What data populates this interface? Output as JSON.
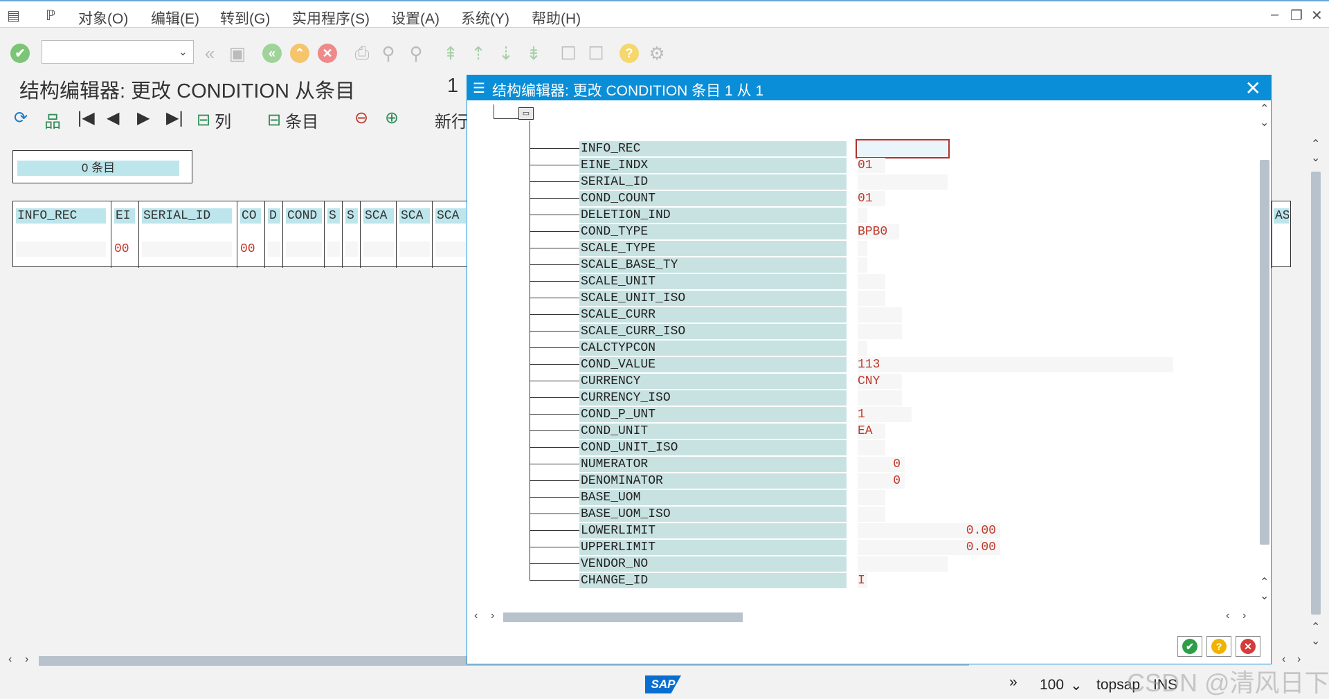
{
  "menu": {
    "items": [
      "对象(O)",
      "编辑(E)",
      "转到(G)",
      "实用程序(S)",
      "设置(A)",
      "系统(Y)",
      "帮助(H)"
    ]
  },
  "window_controls": {
    "minimize": "–",
    "restore": "❐",
    "close": "✕"
  },
  "toolbar": {
    "command_field_value": "",
    "icons": [
      "check-icon",
      "back-icon",
      "save-icon",
      "green-back-icon",
      "up-icon",
      "cancel-icon",
      "print-icon",
      "find-icon",
      "find-next-icon",
      "first-page-icon",
      "prev-page-icon",
      "next-page-icon",
      "last-page-icon",
      "create-session-icon",
      "shortcut-icon",
      "help-icon",
      "settings-icon"
    ]
  },
  "page": {
    "title": "结构编辑器: 更改 CONDITION 从条目",
    "title_num": "1"
  },
  "app_toolbar": {
    "col_label": "列",
    "entry_label": "条目",
    "new_row_label": "新行"
  },
  "count_box": {
    "label": "0 条目"
  },
  "grid": {
    "columns": [
      {
        "header": "INFO_REC",
        "value": ""
      },
      {
        "header": "EI",
        "value": "00"
      },
      {
        "header": "SERIAL_ID",
        "value": ""
      },
      {
        "header": "CO",
        "value": "00"
      },
      {
        "header": "D",
        "value": ""
      },
      {
        "header": "COND",
        "value": ""
      },
      {
        "header": "S",
        "value": ""
      },
      {
        "header": "S",
        "value": ""
      },
      {
        "header": "SCA",
        "value": ""
      },
      {
        "header": "SCA",
        "value": ""
      },
      {
        "header": "SCA",
        "value": ""
      }
    ],
    "right_header": "AS"
  },
  "dialog": {
    "title": "结构编辑器: 更改 CONDITION 条目 1 从 1",
    "fields": [
      {
        "name": "INFO_REC",
        "value": ""
      },
      {
        "name": "EINE_INDX",
        "value": "01"
      },
      {
        "name": "SERIAL_ID",
        "value": ""
      },
      {
        "name": "COND_COUNT",
        "value": "01"
      },
      {
        "name": "DELETION_IND",
        "value": ""
      },
      {
        "name": "COND_TYPE",
        "value": "BPB0"
      },
      {
        "name": "SCALE_TYPE",
        "value": ""
      },
      {
        "name": "SCALE_BASE_TY",
        "value": ""
      },
      {
        "name": "SCALE_UNIT",
        "value": ""
      },
      {
        "name": "SCALE_UNIT_ISO",
        "value": ""
      },
      {
        "name": "SCALE_CURR",
        "value": ""
      },
      {
        "name": "SCALE_CURR_ISO",
        "value": ""
      },
      {
        "name": "CALCTYPCON",
        "value": ""
      },
      {
        "name": "COND_VALUE",
        "value": "113"
      },
      {
        "name": "CURRENCY",
        "value": "CNY"
      },
      {
        "name": "CURRENCY_ISO",
        "value": ""
      },
      {
        "name": "COND_P_UNT",
        "value": "1"
      },
      {
        "name": "COND_UNIT",
        "value": "EA"
      },
      {
        "name": "COND_UNIT_ISO",
        "value": ""
      },
      {
        "name": "NUMERATOR",
        "value": "0"
      },
      {
        "name": "DENOMINATOR",
        "value": "0"
      },
      {
        "name": "BASE_UOM",
        "value": ""
      },
      {
        "name": "BASE_UOM_ISO",
        "value": ""
      },
      {
        "name": "LOWERLIMIT",
        "value": "0.00"
      },
      {
        "name": "UPPERLIMIT",
        "value": "0.00"
      },
      {
        "name": "VENDOR_NO",
        "value": ""
      },
      {
        "name": "CHANGE_ID",
        "value": "I"
      }
    ]
  },
  "status": {
    "sap_logo": "SAP",
    "zoom": "100",
    "system": "topsap",
    "mode": "INS"
  },
  "watermark": "CSDN @清风日下",
  "colors": {
    "dialog_title": "#0a8ed8",
    "field_name_bg": "#c8e2e2",
    "value_text": "#c0392b",
    "header_bg": "#bde5ec"
  }
}
